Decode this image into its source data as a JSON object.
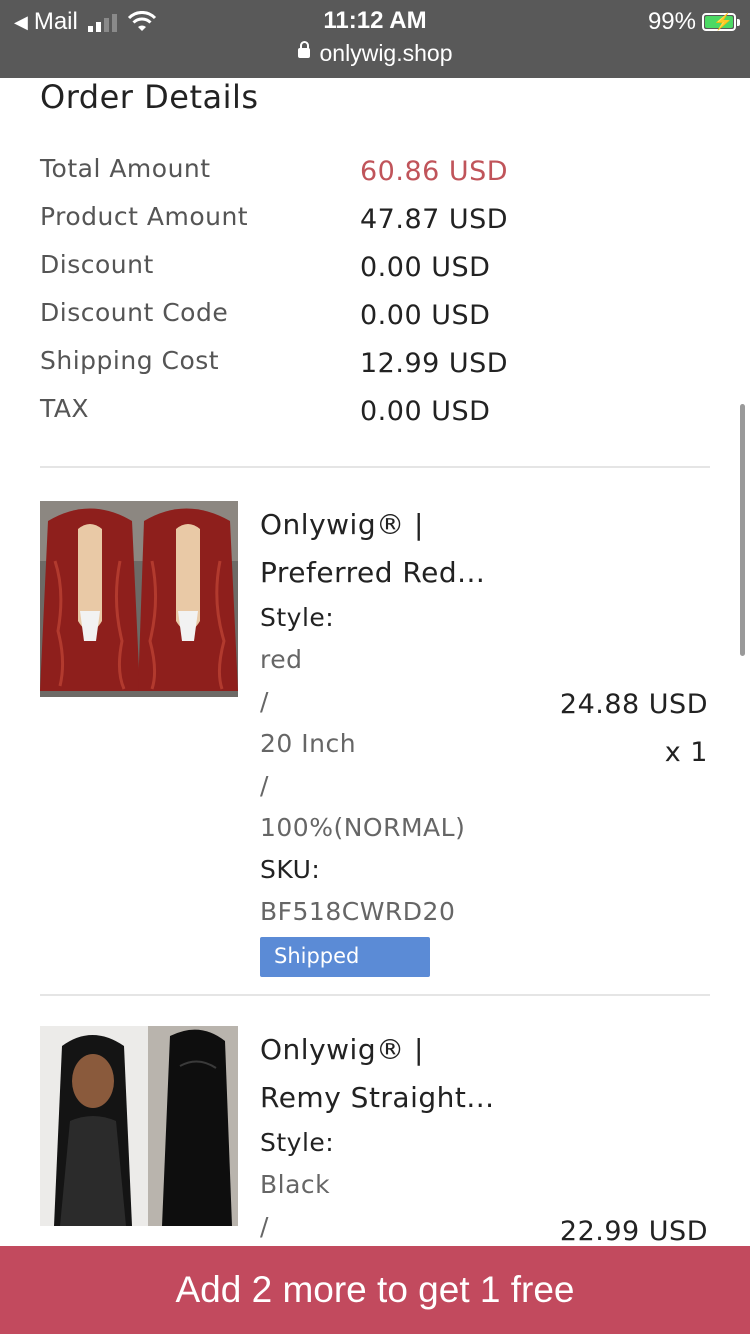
{
  "status_bar": {
    "back_app": "Mail",
    "time": "11:12 AM",
    "url": "onlywig.shop",
    "battery": "99%"
  },
  "order": {
    "title": "Order Details",
    "summary": [
      {
        "label": "Total Amount",
        "value": "60.86 USD"
      },
      {
        "label": "Product Amount",
        "value": "47.87 USD"
      },
      {
        "label": "Discount",
        "value": "0.00 USD"
      },
      {
        "label": "Discount Code",
        "value": "0.00 USD"
      },
      {
        "label": "Shipping Cost",
        "value": "12.99 USD"
      },
      {
        "label": "TAX",
        "value": "0.00 USD"
      }
    ]
  },
  "items": [
    {
      "name_line1": "Onlywig® |",
      "name_line2": "Preferred Red...",
      "style_label": "Style:",
      "style_values": [
        "red",
        "/",
        "20 Inch",
        "/",
        "100%(NORMAL)"
      ],
      "sku_label": "SKU:",
      "sku": "BF518CWRD20",
      "status": "Shipped",
      "price": "24.88 USD",
      "quantity": "x 1",
      "image": "red curly wig on mannequin heads"
    },
    {
      "name_line1": "Onlywig® |",
      "name_line2": "Remy Straight...",
      "style_label": "Style:",
      "style_values": [
        "Black",
        "/"
      ],
      "price": "22.99 USD",
      "image": "long black straight hair wig"
    }
  ],
  "promo_banner": "Add 2 more to get 1 free",
  "colors": {
    "accent_total": "#c0545a",
    "status_badge": "#5b8bd6",
    "promo_bg": "#c24a5e"
  }
}
